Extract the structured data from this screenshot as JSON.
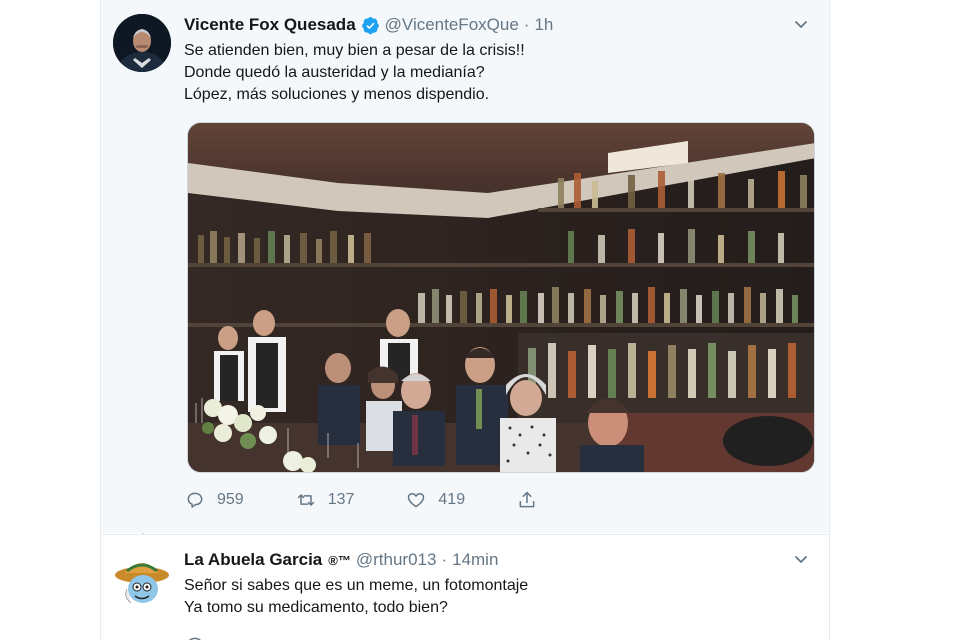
{
  "tweet": {
    "author_name": "Vicente Fox Quesada",
    "handle": "@VicenteFoxQue",
    "separator": "·",
    "time": "1h",
    "lines": [
      "Se atienden bien, muy bien a pesar de la crisis!!",
      "Donde quedó la austeridad  y la medianía?",
      "López, más soluciones y menos dispendio."
    ],
    "counts": {
      "replies": "959",
      "retweets": "137",
      "likes": "419"
    },
    "avatar_icon": "profile-photo",
    "verified_icon": "verified-badge-icon",
    "accent_color": "#1da1f2"
  },
  "reply": {
    "author_name": "La Abuela Garcia",
    "name_badge": "®™",
    "handle": "@rthur013",
    "separator": "·",
    "time": "14min",
    "lines": [
      "Señor si sabes que es un meme, un fotomontaje",
      "Ya tomo su medicamento, todo bien?"
    ]
  },
  "colors": {
    "background": "#f5f8fa",
    "text": "#14171a",
    "muted": "#657786",
    "border": "#e6ecf0"
  }
}
